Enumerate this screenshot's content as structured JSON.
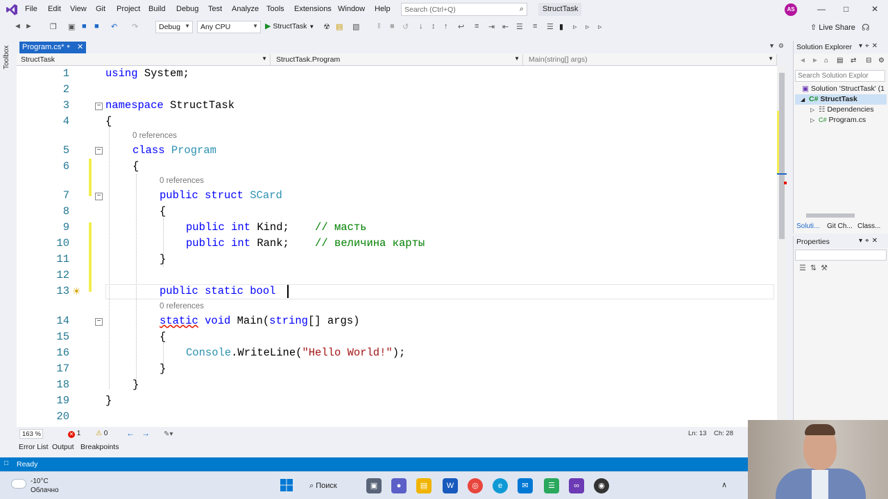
{
  "menubar": {
    "items": [
      "File",
      "Edit",
      "View",
      "Git",
      "Project",
      "Build",
      "Debug",
      "Test",
      "Analyze",
      "Tools",
      "Extensions",
      "Window",
      "Help"
    ],
    "search_placeholder": "Search (Ctrl+Q)",
    "solution_title": "StructTask",
    "user_initials": "AS"
  },
  "toolbar": {
    "config": "Debug",
    "platform": "Any CPU",
    "run_label": "StructTask",
    "live_share": "Live Share"
  },
  "toolbox_label": "Toolbox",
  "tab": {
    "label": "Program.cs*"
  },
  "navbar": {
    "project": "StructTask",
    "type": "StructTask.Program",
    "member": "Main(string[] args)"
  },
  "editor": {
    "line_numbers": [
      "1",
      "2",
      "3",
      "4",
      "5",
      "6",
      "7",
      "8",
      "9",
      "10",
      "11",
      "12",
      "13",
      "14",
      "15",
      "16",
      "17",
      "18",
      "19",
      "20"
    ],
    "references": "0 references",
    "lines": {
      "l1_kw": "using",
      "l1_rest": " System;",
      "l3_kw": "namespace",
      "l3_rest": " StructTask",
      "brace_open": "{",
      "brace_close": "}",
      "l5_kw": "class",
      "l5_type": "Program",
      "l7_kw": "public struct",
      "l7_type": "SCard",
      "l9_kw": "public int",
      "l9_rest": " Kind;",
      "l9_cm": "// масть",
      "l10_kw": "public int",
      "l10_rest": " Rank;",
      "l10_cm": "// величина карты",
      "l13_kw": "public static bool",
      "l14_static": "static",
      "l14_kw": " void",
      "l14_rest": " Main(",
      "l14_kw2": "string",
      "l14_rest2": "[] args)",
      "l16_type": "Console",
      "l16_rest": ".WriteLine(",
      "l16_str": "\"Hello World!\"",
      "l16_end": ");"
    }
  },
  "status_row": {
    "zoom": "163 %",
    "errors": "1",
    "warnings": "0",
    "ln": "Ln: 13",
    "ch": "Ch: 28"
  },
  "bottom_tabs": [
    "Error List",
    "Output",
    "Breakpoints"
  ],
  "statusbar": {
    "text": "Ready"
  },
  "solution_explorer": {
    "title": "Solution Explorer",
    "search_placeholder": "Search Solution Explor",
    "solution_node": "Solution 'StructTask' (1",
    "project_node": "StructTask",
    "dependencies": "Dependencies",
    "program_file": "Program.cs",
    "tabs": [
      "Soluti...",
      "Git Ch...",
      "Class..."
    ]
  },
  "properties": {
    "title": "Properties"
  },
  "taskbar": {
    "temperature": "-10°C",
    "weather": "Облачно",
    "search_label": "Поиск"
  },
  "colors": {
    "accent": "#007acc",
    "tab_active": "#1e68c8",
    "keyword": "#0000ff",
    "type": "#2b91af",
    "string": "#a31515",
    "comment": "#008000",
    "line_number": "#237893"
  }
}
